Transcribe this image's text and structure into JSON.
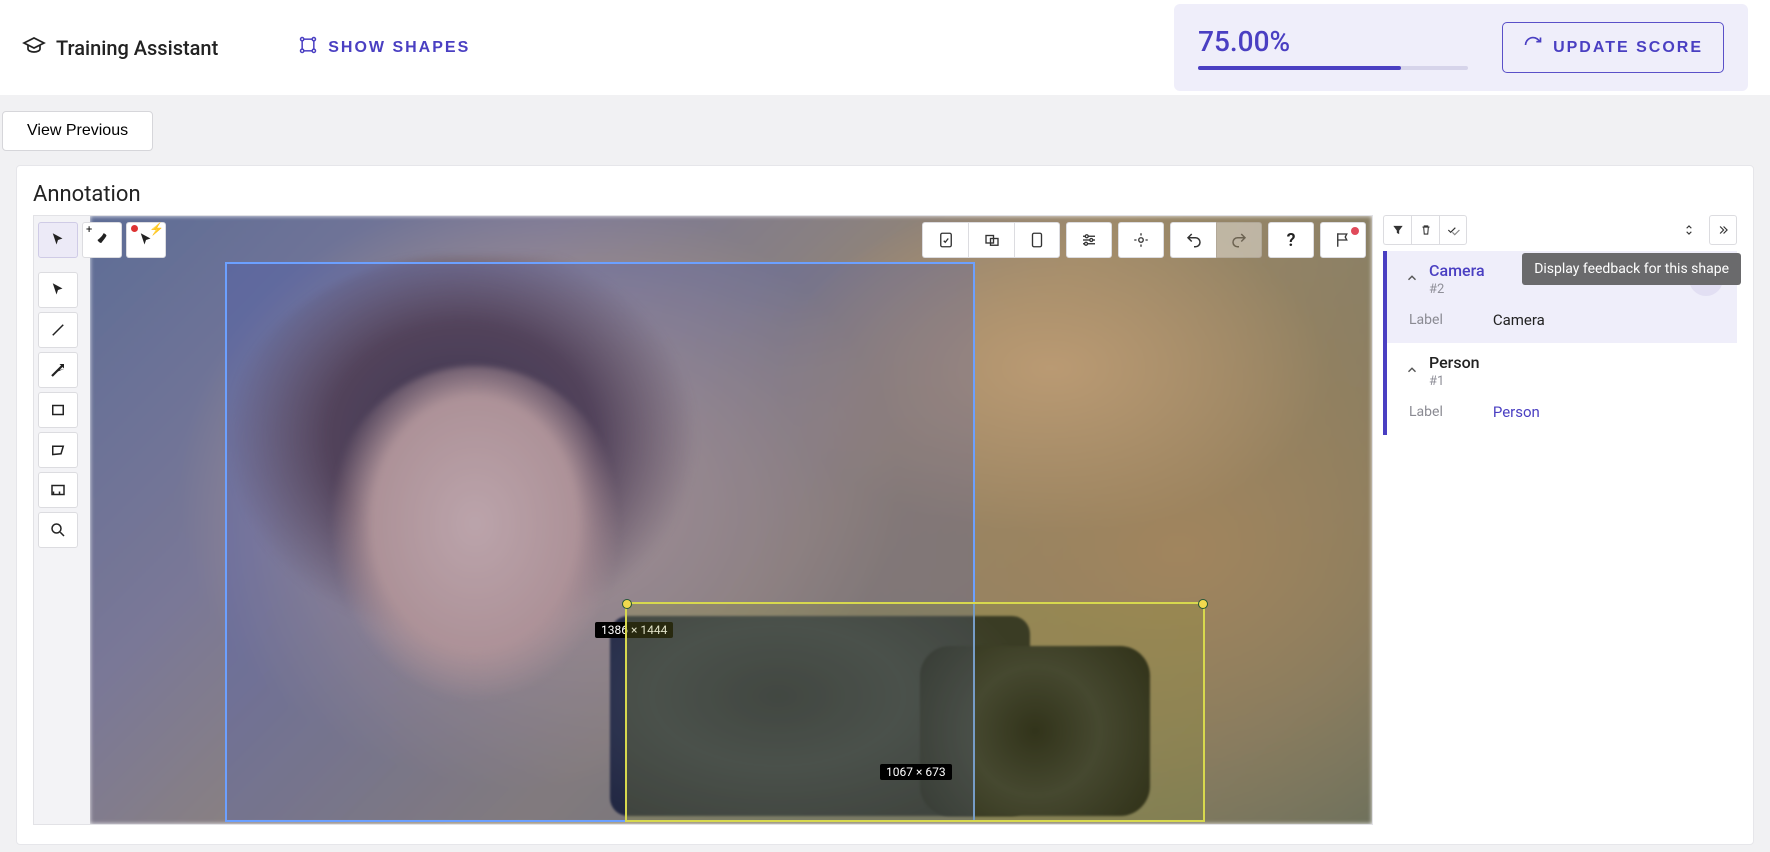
{
  "header": {
    "brand": "Training Assistant",
    "show_shapes": "SHOW SHAPES",
    "score_text": "75.00%",
    "score_pct": 75,
    "update_score": "UPDATE SCORE"
  },
  "nav": {
    "view_previous": "View Previous"
  },
  "panel": {
    "title": "Annotation"
  },
  "boxes": {
    "person_dim": "1386 × 1444",
    "camera_dim": "1067 × 673"
  },
  "shapes": [
    {
      "name": "Camera",
      "index": "#2",
      "label_key": "Label",
      "label_value": "Camera"
    },
    {
      "name": "Person",
      "index": "#1",
      "label_key": "Label",
      "label_value": "Person"
    }
  ],
  "tooltip": "Display feedback for this shape"
}
